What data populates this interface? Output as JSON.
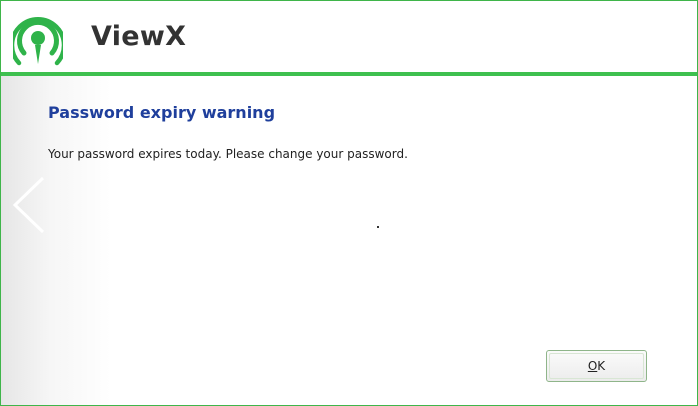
{
  "app": {
    "title": "ViewX",
    "brand_color": "#3ec04f",
    "logo_icon": "wireless-signal-logo-icon"
  },
  "dialog": {
    "title": "Password expiry warning",
    "message": "Your password expires today. Please change your password.",
    "title_color": "#1f3f9c"
  },
  "nav": {
    "back_icon": "chevron-left-icon"
  },
  "buttons": {
    "ok": {
      "mnemonic": "O",
      "rest": "K"
    }
  }
}
